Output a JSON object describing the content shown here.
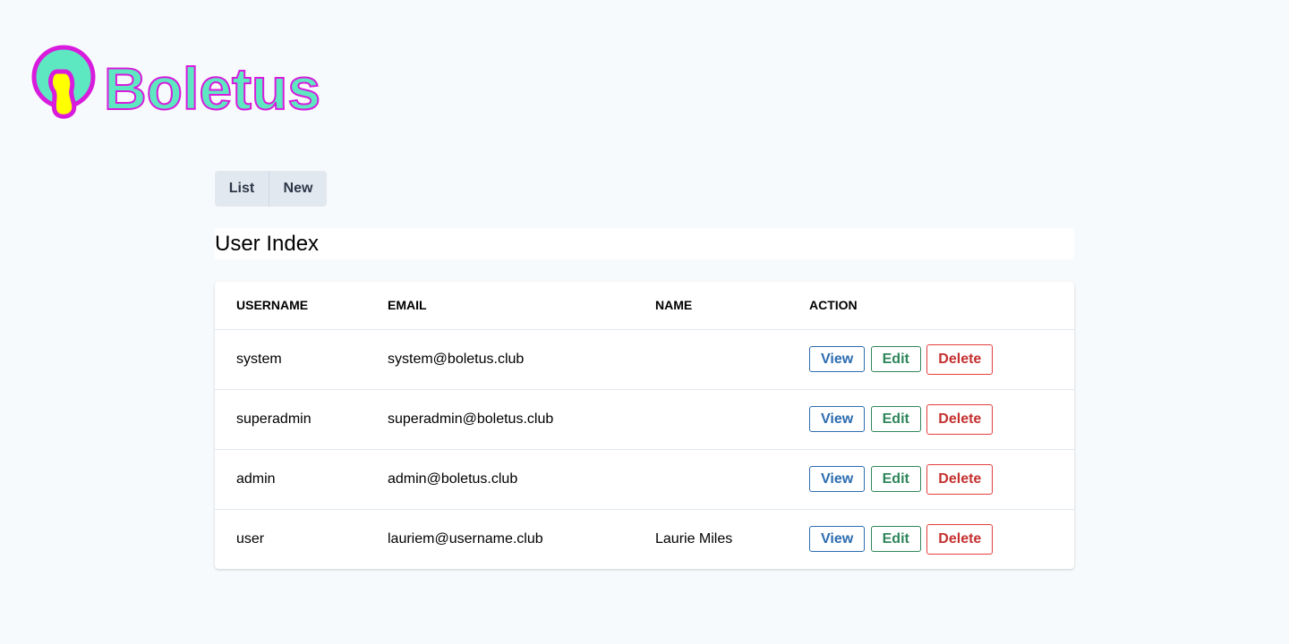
{
  "app": {
    "brand_name": "Boletus",
    "colors": {
      "background": "#f7fafc",
      "logo_fill": "#5ee8c2",
      "logo_stroke": "#d81bdd",
      "logo_yellow": "#ffff00",
      "view": "#2b6cb0",
      "edit": "#2f855a",
      "delete": "#c53030"
    }
  },
  "tabs": [
    {
      "label": "List"
    },
    {
      "label": "New"
    }
  ],
  "page_title": "User Index",
  "table": {
    "headers": {
      "username": "Username",
      "email": "Email",
      "name": "Name",
      "action": "Action"
    },
    "rows": [
      {
        "username": "system",
        "email": "system@boletus.club",
        "name": ""
      },
      {
        "username": "superadmin",
        "email": "superadmin@boletus.club",
        "name": ""
      },
      {
        "username": "admin",
        "email": "admin@boletus.club",
        "name": ""
      },
      {
        "username": "user",
        "email": "lauriem@username.club",
        "name": "Laurie Miles"
      }
    ],
    "actions": {
      "view": "View",
      "edit": "Edit",
      "delete": "Delete"
    }
  }
}
